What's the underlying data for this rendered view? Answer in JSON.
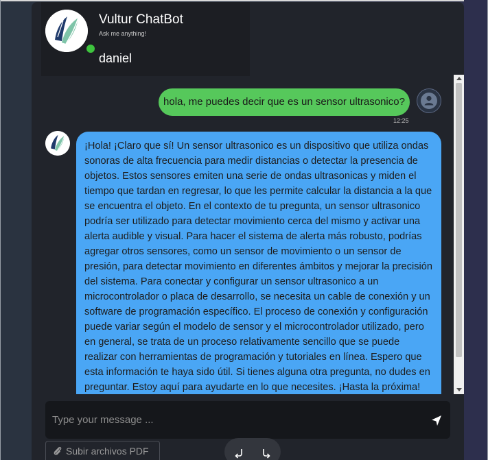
{
  "header": {
    "title": "Vultur ChatBot",
    "subtitle": "Ask me anything!",
    "username": "daniel"
  },
  "messages": {
    "user": {
      "text": "hola, me puedes decir que es un sensor ultrasonico?",
      "time": "12:25"
    },
    "bot": {
      "text": "¡Hola! ¡Claro que sí! Un sensor ultrasonico es un dispositivo que utiliza ondas sonoras de alta frecuencia para medir distancias o detectar la presencia de objetos. Estos sensores emiten una serie de ondas ultrasonicas y miden el tiempo que tardan en regresar, lo que les permite calcular la distancia a la que se encuentra el objeto. En el contexto de tu pregunta, un sensor ultrasonico podría ser utilizado para detectar movimiento cerca del mismo y activar una alerta audible y visual. Para hacer el sistema de alerta más robusto, podrías agregar otros sensores, como un sensor de movimiento o un sensor de presión, para detectar movimiento en diferentes ámbitos y mejorar la precisión del sistema. Para conectar y configurar un sensor ultrasonico a un microcontrolador o placa de desarrollo, se necesita un cable de conexión y un software de programación específico. El proceso de conexión y configuración puede variar según el modelo de sensor y el microcontrolador utilizado, pero en general, se trata de un proceso relativamente sencillo que se puede realizar con herramientas de programación y tutoriales en línea. Espero que esta información te haya sido útil. Si tienes alguna otra pregunta, no dudes en preguntar. Estoy aquí para ayudarte en lo que necesites. ¡Hasta la próxima!"
    }
  },
  "input": {
    "placeholder": "Type your message ..."
  },
  "upload": {
    "label": "Subir archivos PDF"
  },
  "colors": {
    "user_bubble": "#56c85b",
    "bot_bubble": "#4aa6f5",
    "online": "#3ec43e",
    "window": "#21242b"
  },
  "icons": {
    "bot_logo": "feather-logo",
    "user_avatar": "person-icon",
    "send": "send-plane-icon",
    "upload": "paperclip-icon",
    "nav_left": "undo-arrow-icon",
    "nav_right": "redo-arrow-icon"
  }
}
